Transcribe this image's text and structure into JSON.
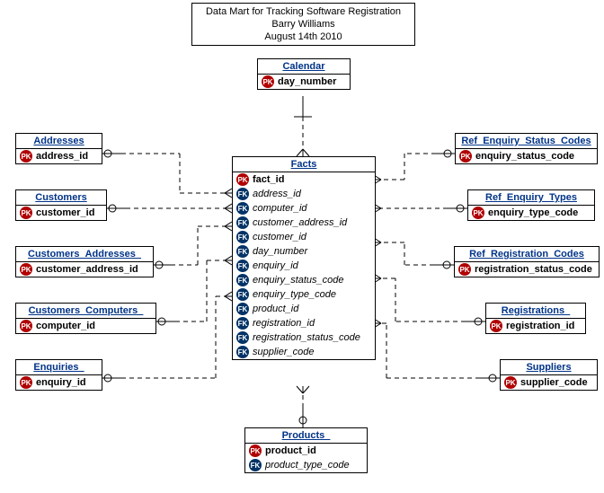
{
  "title": {
    "line1": "Data Mart for Tracking Software Registration",
    "line2": "Barry Williams",
    "line3": "August 14th 2010"
  },
  "entities": {
    "calendar": {
      "name": "Calendar",
      "cols": [
        {
          "k": "pk",
          "n": "day_number",
          "b": true
        }
      ]
    },
    "addresses": {
      "name": "Addresses",
      "cols": [
        {
          "k": "pk",
          "n": "address_id",
          "b": true
        }
      ]
    },
    "customers": {
      "name": "Customers",
      "cols": [
        {
          "k": "pk",
          "n": "customer_id",
          "b": true
        }
      ]
    },
    "cust_addr": {
      "name": "Customers_Addresses_",
      "cols": [
        {
          "k": "pk",
          "n": "customer_address_id",
          "b": true
        }
      ]
    },
    "cust_comp": {
      "name": "Customers_Computers_",
      "cols": [
        {
          "k": "pk",
          "n": "computer_id",
          "b": true
        }
      ]
    },
    "enquiries": {
      "name": "Enquiries_",
      "cols": [
        {
          "k": "pk",
          "n": "enquiry_id",
          "b": true
        }
      ]
    },
    "ref_status": {
      "name": "Ref_Enquiry_Status_Codes",
      "cols": [
        {
          "k": "pk",
          "n": "enquiry_status_code",
          "b": true
        }
      ]
    },
    "ref_types": {
      "name": "Ref_Enquiry_Types",
      "cols": [
        {
          "k": "pk",
          "n": "enquiry_type_code",
          "b": true
        }
      ]
    },
    "ref_reg": {
      "name": "Ref_Registration_Codes",
      "cols": [
        {
          "k": "pk",
          "n": "registration_status_code",
          "b": true
        }
      ]
    },
    "registrations": {
      "name": "Registrations_",
      "cols": [
        {
          "k": "pk",
          "n": "registration_id",
          "b": true
        }
      ]
    },
    "suppliers": {
      "name": "Suppliers",
      "cols": [
        {
          "k": "pk",
          "n": "supplier_code",
          "b": true
        }
      ]
    },
    "products": {
      "name": "Products_",
      "cols": [
        {
          "k": "pk",
          "n": "product_id",
          "b": true
        },
        {
          "k": "fk",
          "n": "product_type_code",
          "b": false
        }
      ]
    },
    "facts": {
      "name": "Facts",
      "cols": [
        {
          "k": "pk",
          "n": "fact_id",
          "b": true
        },
        {
          "k": "fk",
          "n": "address_id",
          "b": false
        },
        {
          "k": "fk",
          "n": "computer_id",
          "b": false
        },
        {
          "k": "fk",
          "n": "customer_address_id",
          "b": false
        },
        {
          "k": "fk",
          "n": "customer_id",
          "b": false
        },
        {
          "k": "fk",
          "n": "day_number",
          "b": false
        },
        {
          "k": "fk",
          "n": "enquiry_id",
          "b": false
        },
        {
          "k": "fk",
          "n": "enquiry_status_code",
          "b": false
        },
        {
          "k": "fk",
          "n": "enquiry_type_code",
          "b": false
        },
        {
          "k": "fk",
          "n": "product_id",
          "b": false
        },
        {
          "k": "fk",
          "n": "registration_id",
          "b": false
        },
        {
          "k": "fk",
          "n": "registration_status_code",
          "b": false
        },
        {
          "k": "fk",
          "n": "supplier_code",
          "b": false
        }
      ]
    }
  },
  "key_labels": {
    "pk": "PK",
    "fk": "FK"
  }
}
